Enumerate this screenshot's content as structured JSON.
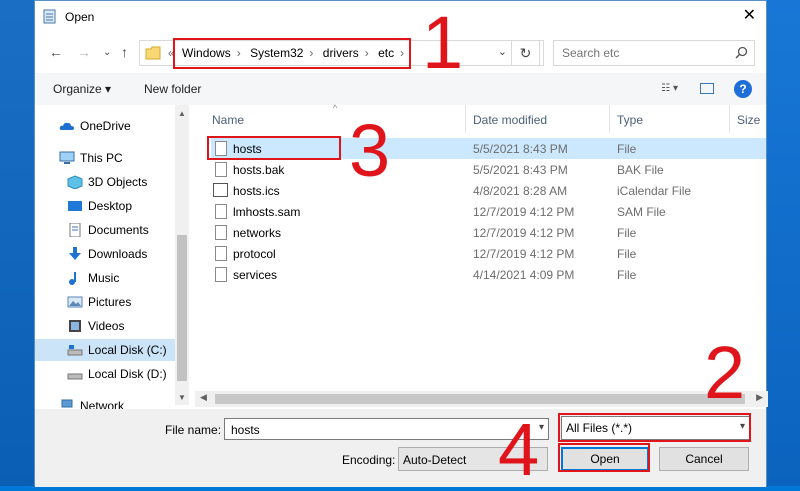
{
  "window": {
    "title": "Open",
    "close_icon": "close-icon"
  },
  "nav": {
    "breadcrumb_overflow": "«",
    "breadcrumb": [
      "Windows",
      "System32",
      "drivers",
      "etc"
    ],
    "search_placeholder": "Search etc"
  },
  "toolbar": {
    "organize": "Organize ▾",
    "new_folder": "New folder",
    "help": "?"
  },
  "sidebar": {
    "items": [
      {
        "label": "OneDrive",
        "icon": "cloud-icon"
      },
      {
        "label": "This PC",
        "icon": "computer-icon"
      },
      {
        "label": "3D Objects",
        "icon": "cube-icon"
      },
      {
        "label": "Desktop",
        "icon": "desktop-icon"
      },
      {
        "label": "Documents",
        "icon": "documents-icon"
      },
      {
        "label": "Downloads",
        "icon": "download-icon"
      },
      {
        "label": "Music",
        "icon": "music-icon"
      },
      {
        "label": "Pictures",
        "icon": "pictures-icon"
      },
      {
        "label": "Videos",
        "icon": "videos-icon"
      },
      {
        "label": "Local Disk (C:)",
        "icon": "drive-icon",
        "selected": true
      },
      {
        "label": "Local Disk (D:)",
        "icon": "drive-icon"
      },
      {
        "label": "Network",
        "icon": "network-icon"
      }
    ]
  },
  "columns": {
    "name": "Name",
    "date": "Date modified",
    "type": "Type",
    "size": "Size"
  },
  "files": [
    {
      "name": "hosts",
      "date": "5/5/2021 8:43 PM",
      "type": "File",
      "selected": true
    },
    {
      "name": "hosts.bak",
      "date": "5/5/2021 8:43 PM",
      "type": "BAK File"
    },
    {
      "name": "hosts.ics",
      "date": "4/8/2021 8:28 AM",
      "type": "iCalendar File"
    },
    {
      "name": "lmhosts.sam",
      "date": "12/7/2019 4:12 PM",
      "type": "SAM File"
    },
    {
      "name": "networks",
      "date": "12/7/2019 4:12 PM",
      "type": "File"
    },
    {
      "name": "protocol",
      "date": "12/7/2019 4:12 PM",
      "type": "File"
    },
    {
      "name": "services",
      "date": "4/14/2021 4:09 PM",
      "type": "File"
    }
  ],
  "bottom": {
    "file_name_label": "File name:",
    "file_name_value": "hosts",
    "file_type": "All Files  (*.*)",
    "encoding_label": "Encoding:",
    "encoding_value": "Auto-Detect",
    "open": "Open",
    "cancel": "Cancel"
  },
  "annotations": [
    "1",
    "2",
    "3",
    "4"
  ],
  "colors": {
    "annotation": "#e0151c",
    "selection": "#cce8ff",
    "accent": "#0078d7"
  }
}
